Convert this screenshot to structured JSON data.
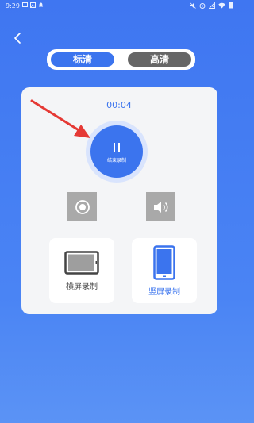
{
  "status_bar": {
    "time": "9:29",
    "left_icons": [
      "message-icon",
      "image-icon",
      "notification-icon"
    ],
    "right_icons": [
      "mute-icon",
      "alarm-icon",
      "signal-off-icon",
      "wifi-icon",
      "battery-icon"
    ]
  },
  "nav": {
    "back_icon": "chevron-left-icon"
  },
  "quality": {
    "options": [
      "标清",
      "高清"
    ],
    "selected": "标清"
  },
  "recorder": {
    "timer": "00:04",
    "action_label": "结束录制",
    "state": "recording"
  },
  "controls": {
    "camera_icon": "record-dot-icon",
    "audio_icon": "speaker-icon"
  },
  "modes": [
    {
      "label": "横屏录制",
      "icon": "landscape-phone-icon"
    },
    {
      "label": "竖屏录制",
      "icon": "portrait-phone-icon",
      "selected": true
    }
  ],
  "colors": {
    "accent": "#3b74ee",
    "background": "#4a84f4",
    "unselected_tab": "#666666",
    "annotation_arrow": "#e53935",
    "control_gray": "#a9a9a9"
  }
}
